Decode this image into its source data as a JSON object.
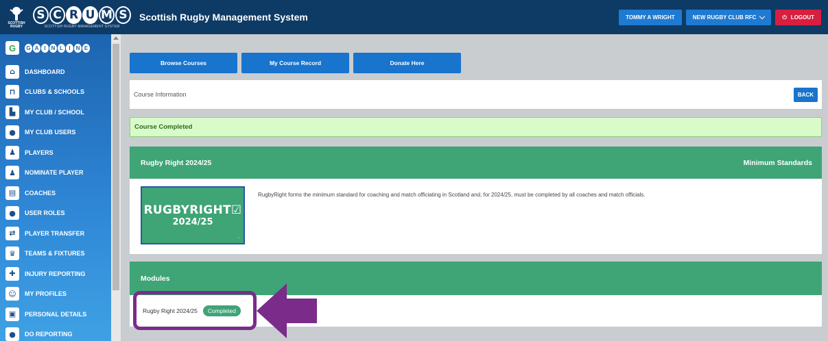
{
  "header": {
    "logo_small_text": "SCOTTISH RUGBY",
    "logo_letters": [
      "S",
      "C",
      "R",
      "U",
      "M",
      "S"
    ],
    "logo_sub": "SCOTTISH RUGBY MANAGEMENT SYSTEM",
    "app_title": "Scottish Rugby Management System",
    "user_button": "TOMMY A WRIGHT",
    "club_select": "NEW RUGBY CLUB RFC",
    "logout_button": "LOGOUT"
  },
  "sidebar": {
    "gainline_letters": [
      "G",
      "A",
      "I",
      "N",
      "L",
      "I",
      "N",
      "E"
    ],
    "items": [
      {
        "label": "DASHBOARD",
        "icon": "home-icon"
      },
      {
        "label": "CLUBS & SCHOOLS",
        "icon": "posts-icon"
      },
      {
        "label": "MY CLUB / SCHOOL",
        "icon": "club-icon"
      },
      {
        "label": "MY CLUB USERS",
        "icon": "users-icon"
      },
      {
        "label": "PLAYERS",
        "icon": "player-icon"
      },
      {
        "label": "NOMINATE PLAYER",
        "icon": "player-icon"
      },
      {
        "label": "COACHES",
        "icon": "clipboard-icon"
      },
      {
        "label": "USER ROLES",
        "icon": "roles-icon"
      },
      {
        "label": "PLAYER TRANSFER",
        "icon": "transfer-icon"
      },
      {
        "label": "TEAMS & FIXTURES",
        "icon": "trophy-icon"
      },
      {
        "label": "INJURY REPORTING",
        "icon": "injury-icon"
      },
      {
        "label": "MY PROFILES",
        "icon": "profile-icon"
      },
      {
        "label": "PERSONAL DETAILS",
        "icon": "details-icon"
      },
      {
        "label": "DO REPORTING",
        "icon": "report-icon"
      }
    ]
  },
  "tabs": {
    "browse": "Browse Courses",
    "record": "My Course Record",
    "donate": "Donate Here"
  },
  "course_info": {
    "label": "Course Information",
    "back": "BACK"
  },
  "status": {
    "message": "Course Completed"
  },
  "course": {
    "title": "Rugby Right 2024/25",
    "category": "Minimum Standards",
    "image_title": "RUGBYRIGHT☑",
    "image_year": "2024/25",
    "description": "RugbyRight forms the minimum standard for coaching and match officiating in Scotland and, for 2024/25, must be completed by all coaches and match officials."
  },
  "modules": {
    "title": "Modules",
    "items": [
      {
        "name": "Rugby Right 2024/25",
        "status": "Completed"
      }
    ]
  },
  "colors": {
    "header_bg": "#0e3a66",
    "primary_blue": "#1874cd",
    "green": "#3fa476",
    "logout_red": "#d81f3f",
    "highlight_purple": "#7b2b8a"
  }
}
